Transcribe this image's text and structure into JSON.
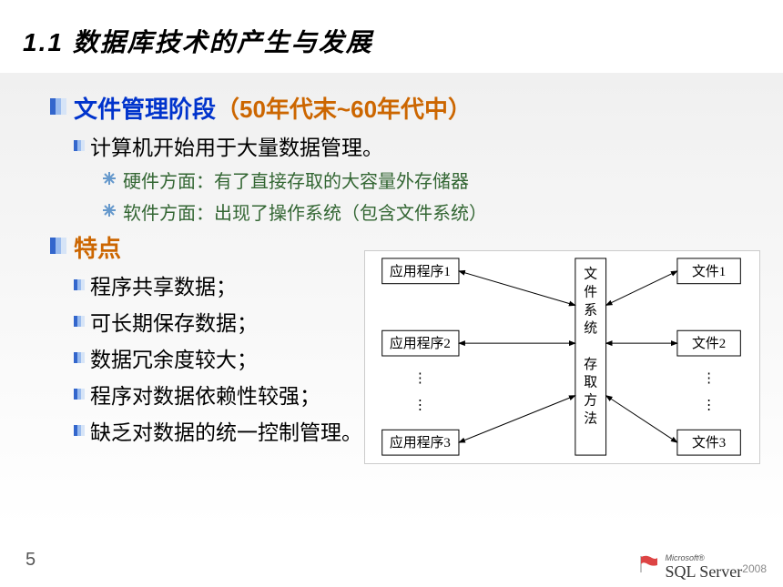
{
  "title": "1.1  数据库技术的产生与发展",
  "section1": {
    "heading": "文件管理阶段",
    "heading_sub": "（50年代末~60年代中）",
    "point1": "计算机开始用于大量数据管理。",
    "sub1": "硬件方面：有了直接存取的大容量外存储器",
    "sub2": "软件方面：出现了操作系统（包含文件系统）"
  },
  "section2": {
    "heading": "特点",
    "items": [
      "程序共享数据；",
      "可长期保存数据；",
      "数据冗余度较大；",
      "程序对数据依赖性较强；",
      "缺乏对数据的统一控制管理。"
    ]
  },
  "diagram": {
    "left": [
      "应用程序1",
      "应用程序2",
      "应用程序3"
    ],
    "middle_top": "文件系统",
    "middle_bottom": "存取方法",
    "right": [
      "文件1",
      "文件2",
      "文件3"
    ]
  },
  "page_number": "5",
  "logo": {
    "brand": "Microsoft®",
    "product": "SQL Server",
    "year": "2008"
  }
}
